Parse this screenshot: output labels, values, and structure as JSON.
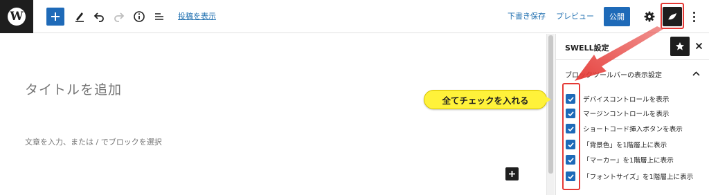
{
  "toolbar": {
    "view_post_label": "投稿を表示",
    "save_draft_label": "下書き保存",
    "preview_label": "プレビュー",
    "publish_label": "公開"
  },
  "editor": {
    "title_placeholder": "タイトルを追加",
    "body_placeholder": "文章を入力、または / でブロックを選択"
  },
  "sidebar": {
    "title": "SWELL設定",
    "panel_title": "ブロックツールバーの表示設定",
    "options": [
      {
        "label": "デバイスコントロールを表示",
        "checked": true
      },
      {
        "label": "マージンコントロールを表示",
        "checked": true
      },
      {
        "label": "ショートコード挿入ボタンを表示",
        "checked": true
      },
      {
        "label": "「背景色」を1階層上に表示",
        "checked": true
      },
      {
        "label": "「マーカー」を1階層上に表示",
        "checked": true
      },
      {
        "label": "「フォントサイズ」を1階層上に表示",
        "checked": true
      }
    ]
  },
  "annotation": {
    "callout_text": "全てチェックを入れる",
    "highlight_color": "#e53935",
    "callout_color": "#fff23a"
  },
  "colors": {
    "accent": "#1e6ab8",
    "link": "#2271b1",
    "dark": "#1e1e1e"
  },
  "icons": {
    "site_logo": "wordpress-logo-icon",
    "add_block": "plus-icon",
    "tools": "pencil-icon",
    "undo": "undo-icon",
    "redo": "redo-icon",
    "details": "info-icon",
    "list_view": "list-view-icon",
    "settings": "gear-icon",
    "swell": "swell-leaf-icon",
    "options": "more-vertical-icon",
    "favorite": "star-icon",
    "close": "close-icon",
    "collapse": "chevron-up-icon",
    "checkbox": "checkmark-icon"
  }
}
